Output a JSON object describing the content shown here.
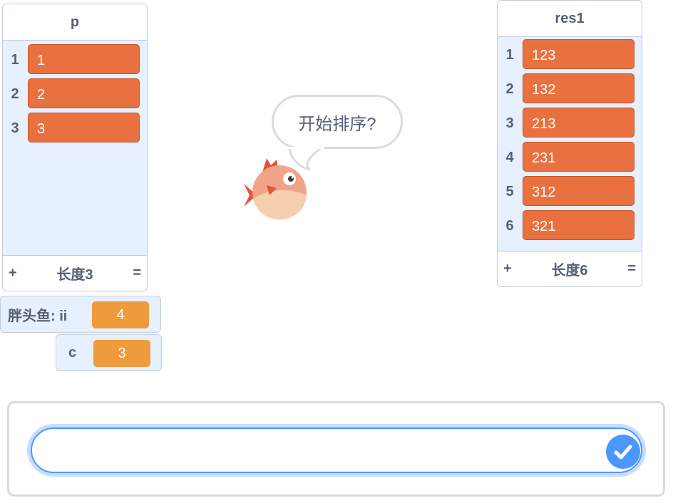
{
  "lists": {
    "p": {
      "title": "p",
      "items": [
        {
          "index": "1",
          "value": "1"
        },
        {
          "index": "2",
          "value": "2"
        },
        {
          "index": "3",
          "value": "3"
        }
      ],
      "add_symbol": "+",
      "length_label": "长度3",
      "resize_symbol": "="
    },
    "res1": {
      "title": "res1",
      "items": [
        {
          "index": "1",
          "value": "123"
        },
        {
          "index": "2",
          "value": "132"
        },
        {
          "index": "3",
          "value": "213"
        },
        {
          "index": "4",
          "value": "231"
        },
        {
          "index": "5",
          "value": "312"
        },
        {
          "index": "6",
          "value": "321"
        }
      ],
      "add_symbol": "+",
      "length_label": "长度6",
      "resize_symbol": "="
    }
  },
  "variables": {
    "ii": {
      "label": "胖头鱼: ii",
      "value": "4"
    },
    "c": {
      "label": "c",
      "value": "3"
    }
  },
  "sprite": {
    "name": "fish-sprite",
    "speech": "开始排序?"
  },
  "ask_prompt": {
    "input_value": ""
  },
  "colors": {
    "list_item": "#e97140",
    "variable_value": "#ef9a3b",
    "monitor_bg": "#e6f0ff",
    "accent": "#4c97ff"
  }
}
